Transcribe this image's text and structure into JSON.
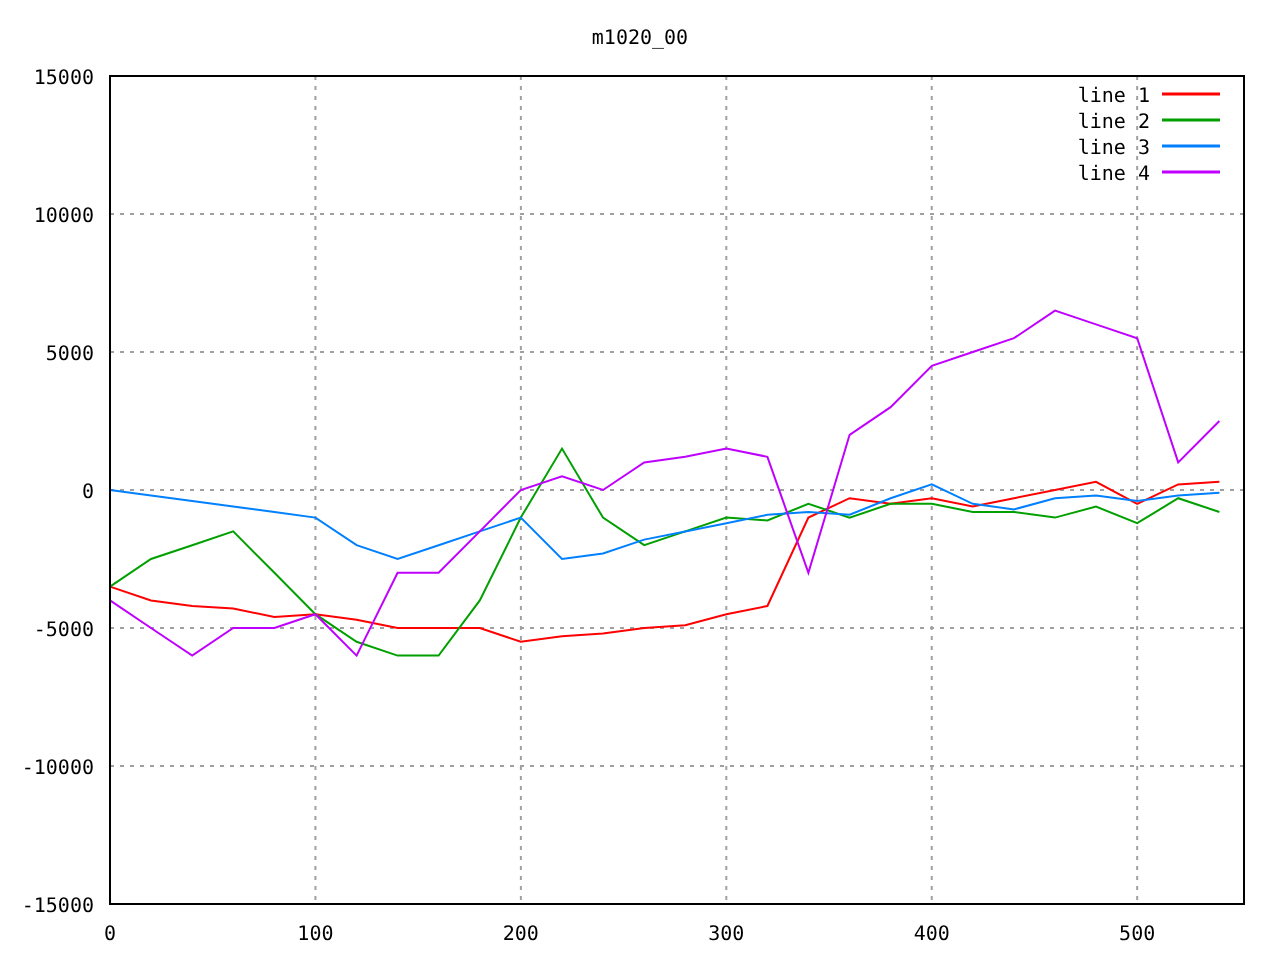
{
  "chart_data": {
    "type": "line",
    "title": "m1020_00",
    "x": [
      0,
      20,
      40,
      60,
      80,
      100,
      120,
      140,
      160,
      180,
      200,
      220,
      240,
      260,
      280,
      300,
      320,
      340,
      360,
      380,
      400,
      420,
      440,
      460,
      480,
      500,
      520,
      540
    ],
    "series": [
      {
        "name": "line 1",
        "color": "#ff0000",
        "values": [
          -3500,
          -4000,
          -4200,
          -4300,
          -4600,
          -4500,
          -4700,
          -5000,
          -5000,
          -5000,
          -5500,
          -5300,
          -5200,
          -5000,
          -4900,
          -4500,
          -4200,
          -1000,
          -300,
          -500,
          -300,
          -600,
          -300,
          0,
          300,
          -500,
          200,
          300
        ]
      },
      {
        "name": "line 2",
        "color": "#00a000",
        "values": [
          -3500,
          -2500,
          -2000,
          -1500,
          -3000,
          -4500,
          -5500,
          -6000,
          -6000,
          -4000,
          -1000,
          1500,
          -1000,
          -2000,
          -1500,
          -1000,
          -1100,
          -500,
          -1000,
          -500,
          -500,
          -800,
          -800,
          -1000,
          -600,
          -1200,
          -300,
          -800
        ]
      },
      {
        "name": "line 3",
        "color": "#0080ff",
        "values": [
          0,
          -200,
          -400,
          -600,
          -800,
          -1000,
          -2000,
          -2500,
          -2000,
          -1500,
          -1000,
          -2500,
          -2300,
          -1800,
          -1500,
          -1200,
          -900,
          -800,
          -900,
          -300,
          200,
          -500,
          -700,
          -300,
          -200,
          -400,
          -200,
          -100
        ]
      },
      {
        "name": "line 4",
        "color": "#c000ff",
        "values": [
          -4000,
          -5000,
          -6000,
          -5000,
          -5000,
          -4500,
          -6000,
          -3000,
          -3000,
          -1500,
          0,
          500,
          0,
          1000,
          1200,
          1500,
          1200,
          -3000,
          2000,
          3000,
          4500,
          5000,
          5500,
          6500,
          6000,
          5500,
          1000,
          2500
        ]
      }
    ],
    "grid": true,
    "legend": true,
    "xlim": [
      0,
      552
    ],
    "ylim": [
      -15000,
      15000
    ],
    "xticks": [
      0,
      100,
      200,
      300,
      400,
      500
    ],
    "yticks": [
      -15000,
      -10000,
      -5000,
      0,
      5000,
      10000,
      15000
    ]
  }
}
